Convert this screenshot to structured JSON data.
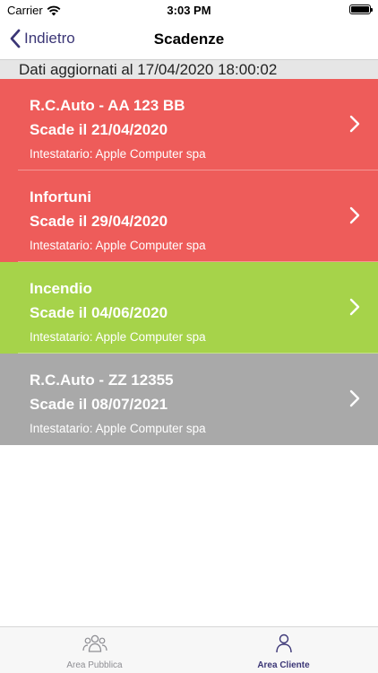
{
  "status": {
    "carrier": "Carrier",
    "time": "3:03 PM"
  },
  "nav": {
    "back_label": "Indietro",
    "title": "Scadenze"
  },
  "updated": "Dati aggiornati al 17/04/2020 18:00:02",
  "items": [
    {
      "title": "R.C.Auto - AA 123 BB",
      "due": "Scade il 21/04/2020",
      "holder": "Intestatario: Apple Computer spa",
      "color": "#ee5c5a"
    },
    {
      "title": "Infortuni",
      "due": "Scade il 29/04/2020",
      "holder": "Intestatario: Apple Computer spa",
      "color": "#ee5c5a"
    },
    {
      "title": "Incendio",
      "due": "Scade il 04/06/2020",
      "holder": "Intestatario: Apple Computer spa",
      "color": "#a6d34a"
    },
    {
      "title": "R.C.Auto - ZZ 12355",
      "due": "Scade il 08/07/2021",
      "holder": "Intestatario: Apple Computer spa",
      "color": "#a9a9a9"
    }
  ],
  "tabs": [
    {
      "label": "Area Pubblica",
      "icon": "group-icon",
      "active": false
    },
    {
      "label": "Area Cliente",
      "icon": "person-icon",
      "active": true
    }
  ],
  "colors": {
    "accent": "#3b3676",
    "inactive": "#8e8e93"
  }
}
